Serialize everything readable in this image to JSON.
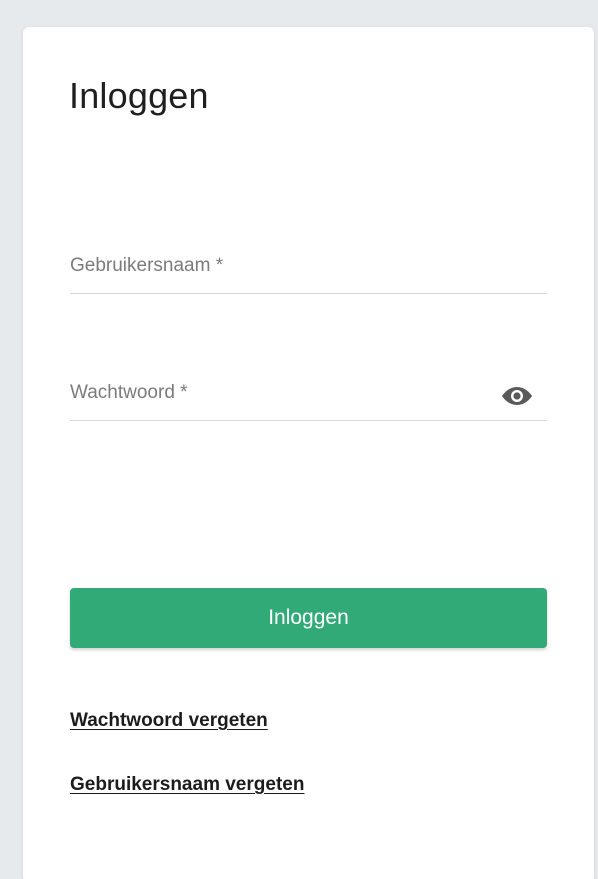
{
  "title": "Inloggen",
  "fields": {
    "username": {
      "label": "Gebruikersnaam *",
      "value": ""
    },
    "password": {
      "label": "Wachtwoord *",
      "value": "",
      "toggle_icon": "eye-icon"
    }
  },
  "login_button": {
    "label": "Inloggen",
    "color": "#31aa78"
  },
  "links": {
    "forgot_password": "Wachtwoord vergeten",
    "forgot_username": "Gebruikersnaam vergeten"
  }
}
